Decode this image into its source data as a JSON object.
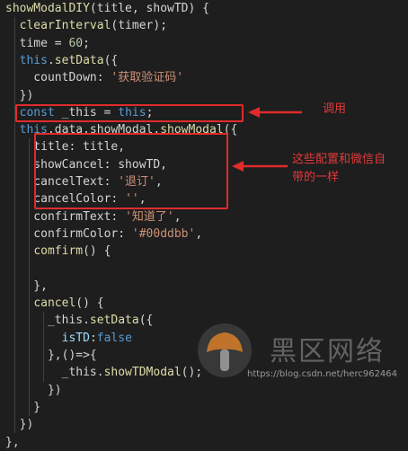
{
  "code": {
    "lines": [
      [
        {
          "t": "showModalDIY",
          "c": "fn"
        },
        {
          "t": "(title, showTD) {",
          "c": "plain"
        }
      ],
      [
        {
          "t": "  ",
          "c": "plain"
        },
        {
          "t": "clearInterval",
          "c": "fn"
        },
        {
          "t": "(timer);",
          "c": "plain"
        }
      ],
      [
        {
          "t": "  time = ",
          "c": "plain"
        },
        {
          "t": "60",
          "c": "num"
        },
        {
          "t": ";",
          "c": "plain"
        }
      ],
      [
        {
          "t": "  ",
          "c": "plain"
        },
        {
          "t": "this",
          "c": "kw"
        },
        {
          "t": ".",
          "c": "plain"
        },
        {
          "t": "setData",
          "c": "fn"
        },
        {
          "t": "({",
          "c": "plain"
        }
      ],
      [
        {
          "t": "    countDown: ",
          "c": "plain"
        },
        {
          "t": "'获取验证码'",
          "c": "str"
        }
      ],
      [
        {
          "t": "  })",
          "c": "plain"
        }
      ],
      [
        {
          "t": "  ",
          "c": "plain"
        },
        {
          "t": "const",
          "c": "kw"
        },
        {
          "t": " _this = ",
          "c": "plain"
        },
        {
          "t": "this",
          "c": "kw"
        },
        {
          "t": ";",
          "c": "plain"
        }
      ],
      [
        {
          "t": "  ",
          "c": "plain"
        },
        {
          "t": "this",
          "c": "kw"
        },
        {
          "t": ".data.showModal.",
          "c": "plain"
        },
        {
          "t": "showModal",
          "c": "fn"
        },
        {
          "t": "({",
          "c": "plain"
        }
      ],
      [
        {
          "t": "    title: title,",
          "c": "plain"
        }
      ],
      [
        {
          "t": "    showCancel: showTD,",
          "c": "plain"
        }
      ],
      [
        {
          "t": "    cancelText: ",
          "c": "plain"
        },
        {
          "t": "'退订'",
          "c": "str"
        },
        {
          "t": ",",
          "c": "plain"
        }
      ],
      [
        {
          "t": "    cancelColor: ",
          "c": "plain"
        },
        {
          "t": "''",
          "c": "str"
        },
        {
          "t": ",",
          "c": "plain"
        }
      ],
      [
        {
          "t": "    confirmText: ",
          "c": "plain"
        },
        {
          "t": "'知道了'",
          "c": "str"
        },
        {
          "t": ",",
          "c": "plain"
        }
      ],
      [
        {
          "t": "    confirmColor: ",
          "c": "plain"
        },
        {
          "t": "'#00ddbb'",
          "c": "str"
        },
        {
          "t": ",",
          "c": "plain"
        }
      ],
      [
        {
          "t": "    ",
          "c": "plain"
        },
        {
          "t": "comfirm",
          "c": "fn"
        },
        {
          "t": "() {",
          "c": "plain"
        }
      ],
      [
        {
          "t": "",
          "c": "plain"
        }
      ],
      [
        {
          "t": "    },",
          "c": "plain"
        }
      ],
      [
        {
          "t": "    ",
          "c": "plain"
        },
        {
          "t": "cancel",
          "c": "fn"
        },
        {
          "t": "() {",
          "c": "plain"
        }
      ],
      [
        {
          "t": "      _this.",
          "c": "plain"
        },
        {
          "t": "setData",
          "c": "fn"
        },
        {
          "t": "({",
          "c": "plain"
        }
      ],
      [
        {
          "t": "        ",
          "c": "plain"
        },
        {
          "t": "isTD",
          "c": "prop"
        },
        {
          "t": ":",
          "c": "plain"
        },
        {
          "t": "false",
          "c": "kw"
        }
      ],
      [
        {
          "t": "      },()=>{",
          "c": "plain"
        }
      ],
      [
        {
          "t": "        _this.",
          "c": "plain"
        },
        {
          "t": "showTDModal",
          "c": "fn"
        },
        {
          "t": "();",
          "c": "plain"
        }
      ],
      [
        {
          "t": "      })",
          "c": "plain"
        }
      ],
      [
        {
          "t": "    }",
          "c": "plain"
        }
      ],
      [
        {
          "t": "  })",
          "c": "plain"
        }
      ],
      [
        {
          "t": "},",
          "c": "plain"
        }
      ]
    ]
  },
  "annotations": {
    "call_label": "调用",
    "config_label_line1": "这些配置和微信自",
    "config_label_line2": "带的一样",
    "accent_color": "#e02b2b"
  },
  "watermark": {
    "brand_text": "黑区网络",
    "url_text": "https://blog.csdn.net/herc962464",
    "logo_icon": "mushroom-logo-icon"
  }
}
